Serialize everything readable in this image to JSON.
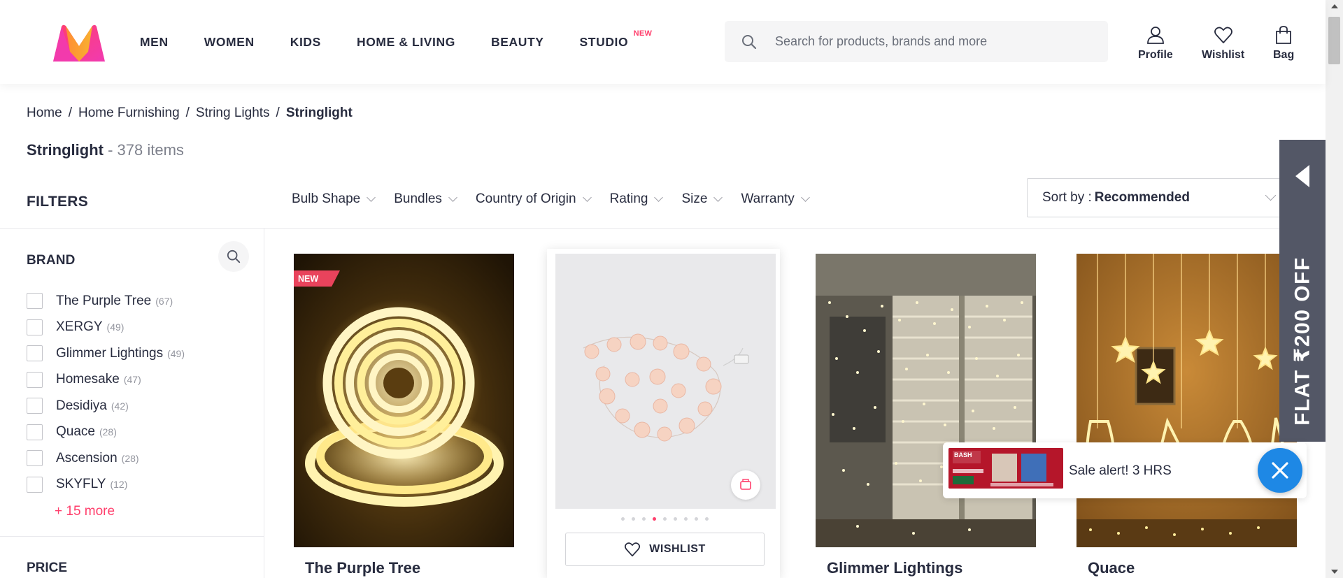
{
  "header": {
    "nav": [
      {
        "label": "MEN"
      },
      {
        "label": "WOMEN"
      },
      {
        "label": "KIDS"
      },
      {
        "label": "HOME & LIVING"
      },
      {
        "label": "BEAUTY"
      },
      {
        "label": "STUDIO",
        "tag": "NEW"
      }
    ],
    "search_placeholder": "Search for products, brands and more",
    "actions": [
      {
        "label": "Profile",
        "icon": "person-icon"
      },
      {
        "label": "Wishlist",
        "icon": "heart-icon"
      },
      {
        "label": "Bag",
        "icon": "bag-icon"
      }
    ]
  },
  "breadcrumb": [
    "Home",
    "Home Furnishing",
    "String Lights",
    "Stringlight"
  ],
  "title": {
    "name": "Stringlight",
    "count": " - 378 items"
  },
  "filters_label": "FILTERS",
  "filter_chips": [
    "Bulb Shape",
    "Bundles",
    "Country of Origin",
    "Rating",
    "Size",
    "Warranty"
  ],
  "sort": {
    "prefix": "Sort by :",
    "value": "Recommended"
  },
  "sidebar": {
    "brand_heading": "BRAND",
    "brands": [
      {
        "name": "The Purple Tree",
        "count": "(67)"
      },
      {
        "name": "XERGY",
        "count": "(49)"
      },
      {
        "name": "Glimmer Lightings",
        "count": "(49)"
      },
      {
        "name": "Homesake",
        "count": "(47)"
      },
      {
        "name": "Desidiya",
        "count": "(42)"
      },
      {
        "name": "Quace",
        "count": "(28)"
      },
      {
        "name": "Ascension",
        "count": "(28)"
      },
      {
        "name": "SKYFLY",
        "count": "(12)"
      }
    ],
    "more": "+ 15 more",
    "price_heading": "PRICE"
  },
  "products": [
    {
      "brand": "The Purple Tree",
      "badge": "NEW"
    },
    {
      "brand": "",
      "wishlist": "WISHLIST",
      "dots": 9,
      "active_dot": 4
    },
    {
      "brand": "Glimmer Lightings"
    },
    {
      "brand": "Quace"
    }
  ],
  "offer_tab": "FLAT ₹200 OFF",
  "sale_alert": {
    "text": "Sale alert! 3 HRS",
    "thumb_text": "BASH"
  },
  "colors": {
    "accent": "#ff3f6c",
    "text": "#282c3f",
    "offer": "#535766",
    "close": "#1e88e5"
  }
}
